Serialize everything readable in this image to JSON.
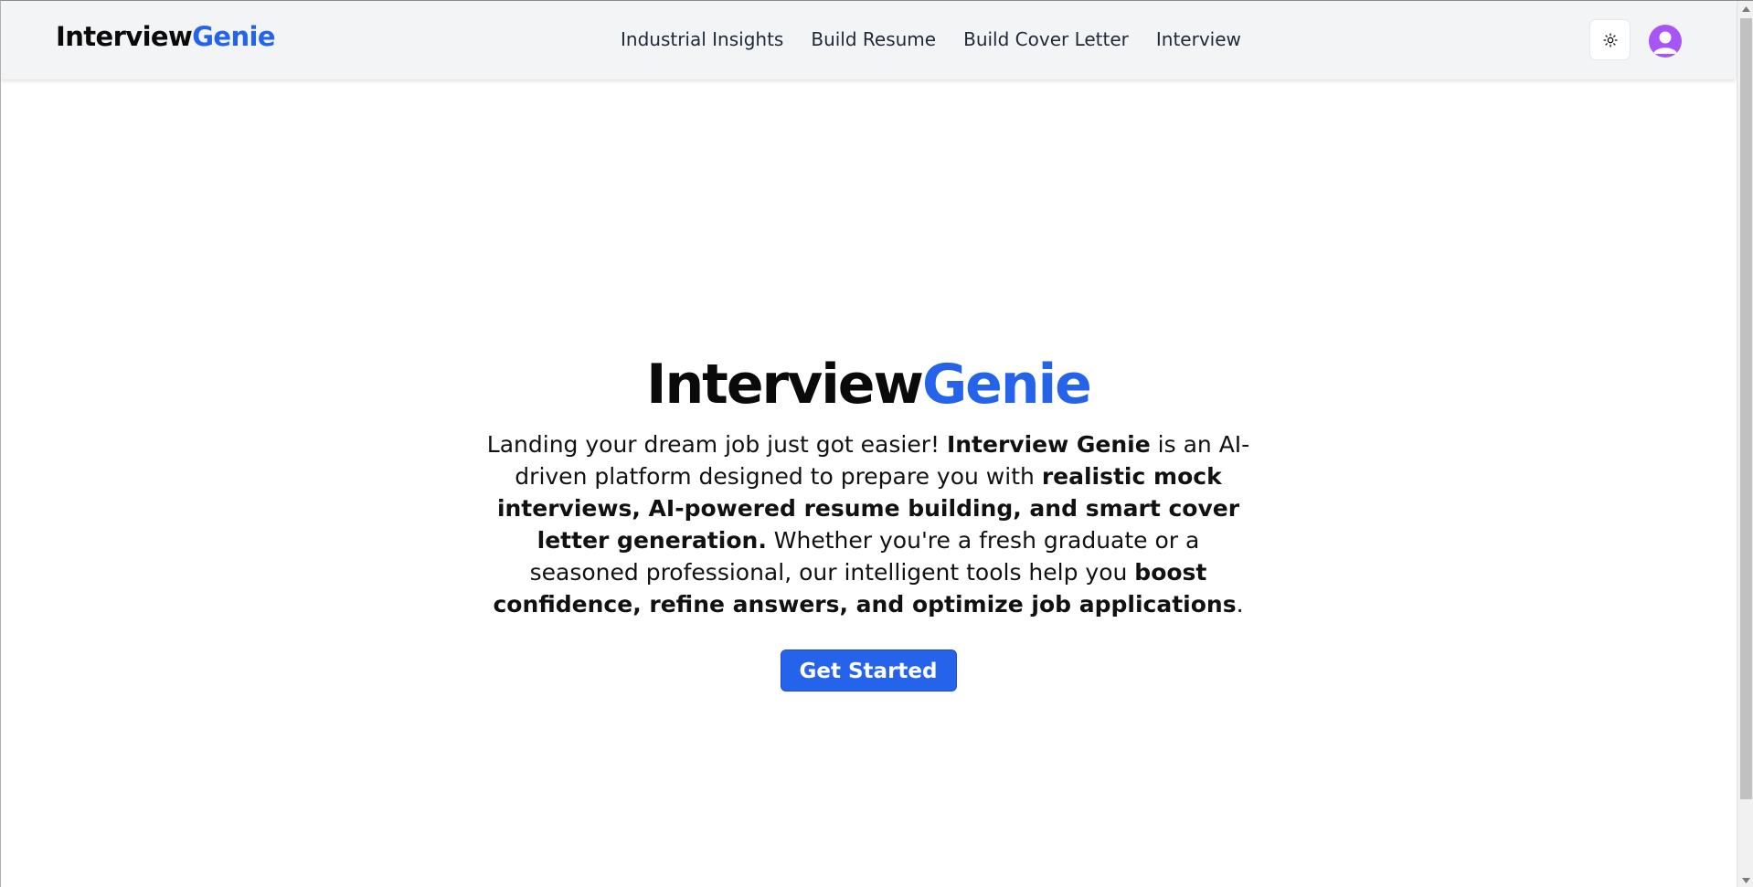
{
  "brand": {
    "part1": "Interview",
    "part2": "Genie"
  },
  "nav": {
    "links": [
      "Industrial Insights",
      "Build Resume",
      "Build Cover Letter",
      "Interview"
    ]
  },
  "header_controls": {
    "theme_icon": "sun-icon",
    "avatar_icon": "user-avatar-icon"
  },
  "hero": {
    "title_part1": "Interview",
    "title_part2": "Genie",
    "text": {
      "s1": "Landing your dream job just got easier! ",
      "b1": "Interview Genie",
      "s2": " is an AI-driven platform designed to prepare you with ",
      "b2": "realistic mock interviews, AI-powered resume building, and smart cover letter generation.",
      "s3": " Whether you're a fresh graduate or a seasoned professional, our intelligent tools help you ",
      "b3": "boost confidence, refine answers, and optimize job applications",
      "s4": "."
    },
    "cta_label": "Get Started"
  },
  "colors": {
    "accent": "#2563eb",
    "avatar": "#a855f7",
    "navbar_bg": "#f3f4f6"
  }
}
